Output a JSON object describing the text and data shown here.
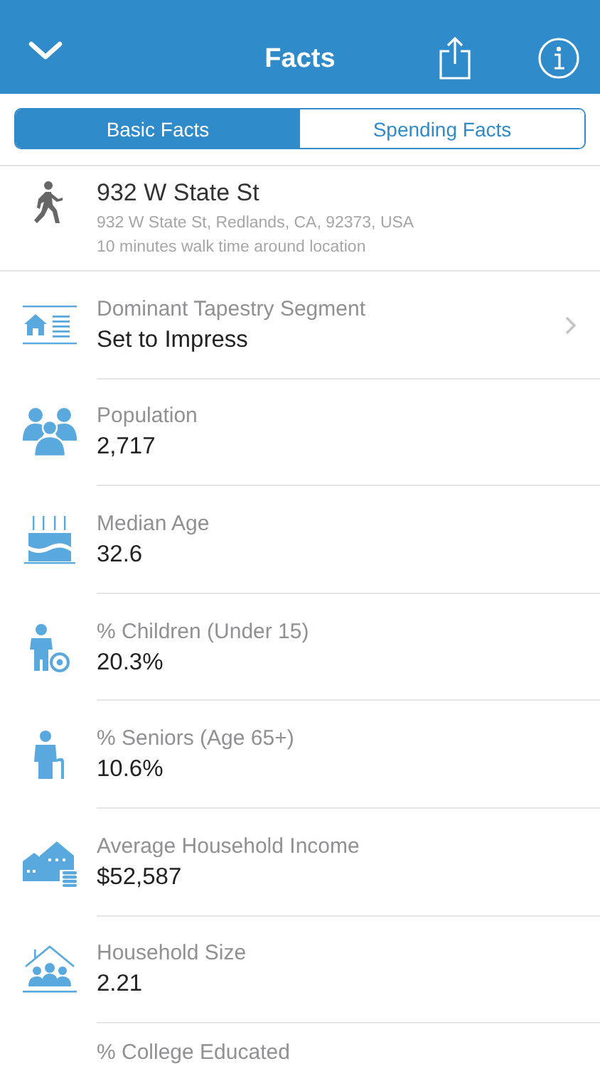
{
  "nav": {
    "title": "Facts"
  },
  "tabs": [
    {
      "label": "Basic Facts",
      "selected": true
    },
    {
      "label": "Spending Facts",
      "selected": false
    }
  ],
  "location": {
    "name": "932 W State St",
    "address": "932 W State St, Redlands, CA, 92373, USA",
    "area": "10 minutes walk time around location"
  },
  "facts": [
    {
      "kind": "tapestry",
      "label": "Dominant Tapestry Segment",
      "value": "Set to Impress",
      "has_detail": true
    },
    {
      "kind": "population",
      "label": "Population",
      "value": "2,717",
      "has_detail": false
    },
    {
      "kind": "age",
      "label": "Median Age",
      "value": "32.6",
      "has_detail": false
    },
    {
      "kind": "children",
      "label": "% Children (Under 15)",
      "value": "20.3%",
      "has_detail": false
    },
    {
      "kind": "seniors",
      "label": "% Seniors (Age 65+)",
      "value": "10.6%",
      "has_detail": false
    },
    {
      "kind": "income",
      "label": "Average Household Income",
      "value": "$52,587",
      "has_detail": false
    },
    {
      "kind": "household",
      "label": "Household Size",
      "value": "2.21",
      "has_detail": false
    },
    {
      "kind": "education",
      "label": "% College Educated",
      "has_detail": false
    }
  ]
}
